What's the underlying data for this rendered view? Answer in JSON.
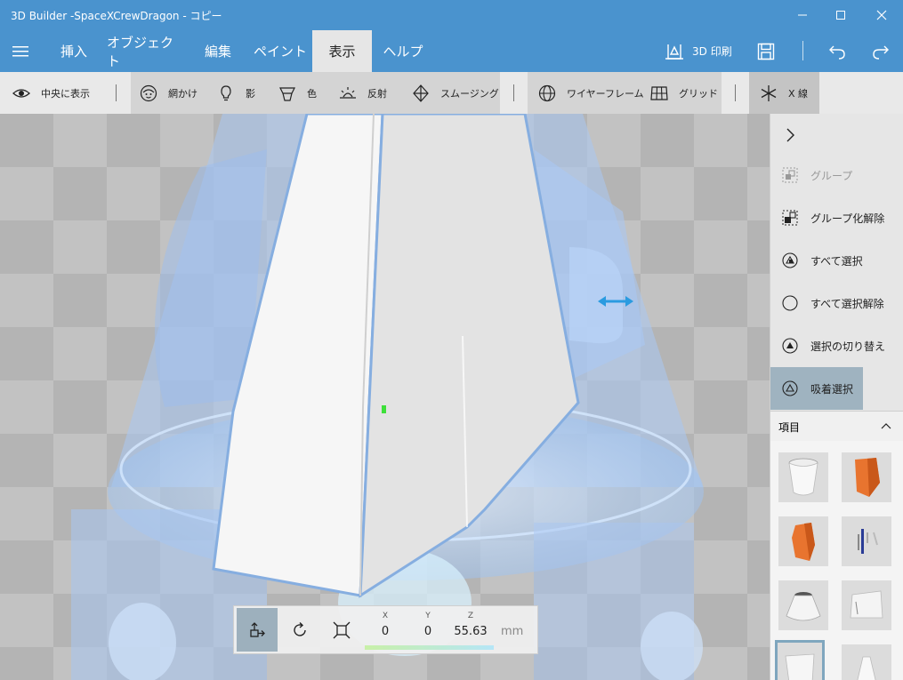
{
  "window": {
    "title": "3D Builder -SpaceXCrewDragon - コピー"
  },
  "menu": {
    "tabs": [
      "挿入",
      "オブジェクト",
      "編集",
      "ペイント",
      "表示",
      "ヘルプ"
    ],
    "active_tab": "表示",
    "print_label": "3D 印刷"
  },
  "toolbar": {
    "center_view": "中央に表示",
    "mesh": "網かけ",
    "shadow": "影",
    "color": "色",
    "reflection": "反射",
    "smoothing": "スムージング",
    "wireframe": "ワイヤーフレーム",
    "grid": "グリッド",
    "xray": "X 線"
  },
  "side_panel": {
    "group": "グループ",
    "ungroup": "グループ化解除",
    "select_all": "すべて選択",
    "deselect_all": "すべて選択解除",
    "invert_selection": "選択の切り替え",
    "snap_select": "吸着選択",
    "items_header": "項目"
  },
  "transform": {
    "x_label": "X",
    "y_label": "Y",
    "z_label": "Z",
    "x": "0",
    "y": "0",
    "z": "55.63",
    "unit": "mm"
  },
  "colors": {
    "accent": "#4a93ce",
    "active_tab_bg": "#e6e6e6",
    "toolbar_active": "#9fb3c0"
  }
}
